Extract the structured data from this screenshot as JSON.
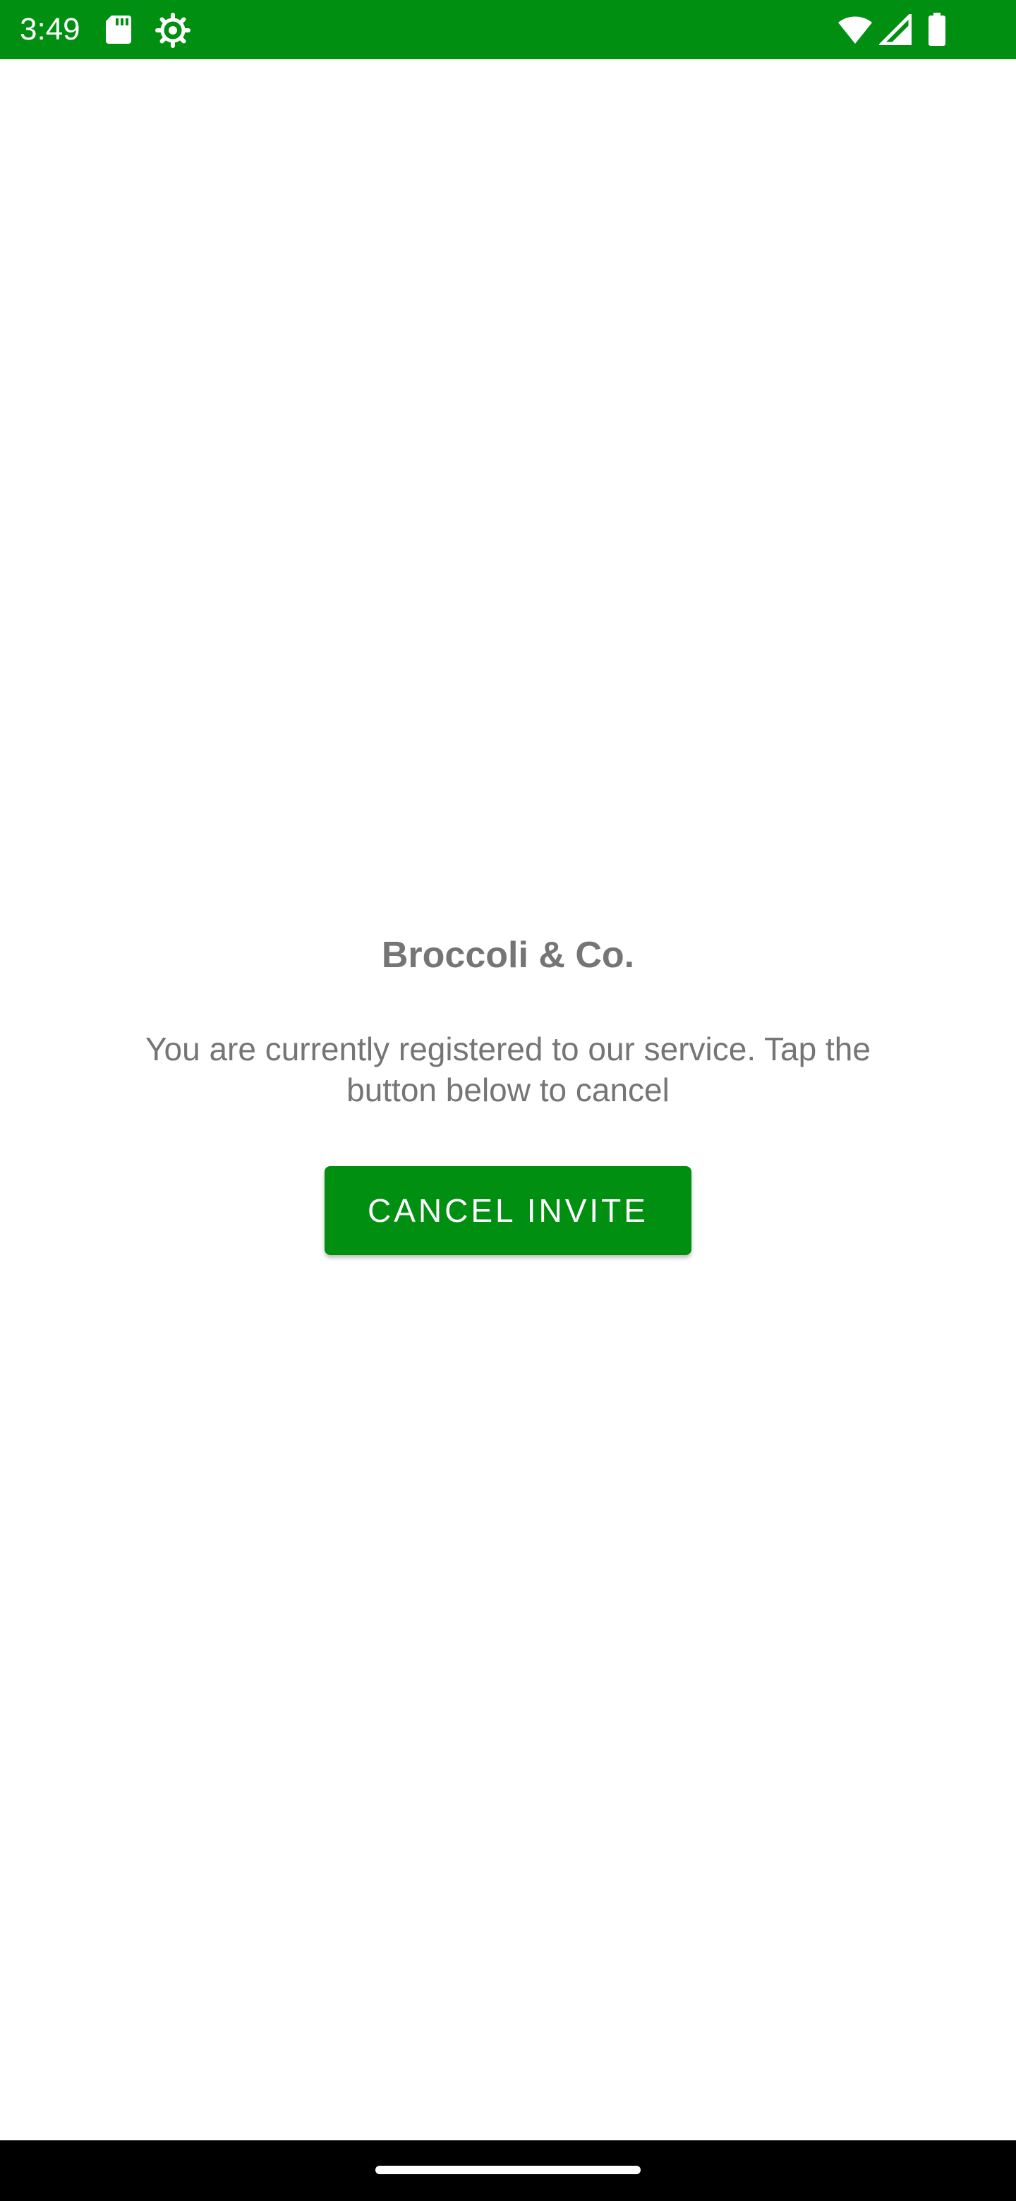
{
  "status_bar": {
    "time": "3:49",
    "icons": [
      "sd-card-icon",
      "settings-gear-icon",
      "wifi-icon",
      "signal-icon",
      "battery-icon"
    ],
    "background_color": "#008f11"
  },
  "main": {
    "title": "Broccoli & Co.",
    "message": "You are currently registered to our service. Tap the button below to cancel",
    "cancel_button_label": "CANCEL INVITE",
    "accent_color": "#008f11"
  },
  "nav_bar": {
    "home_handle": "home-handle"
  }
}
